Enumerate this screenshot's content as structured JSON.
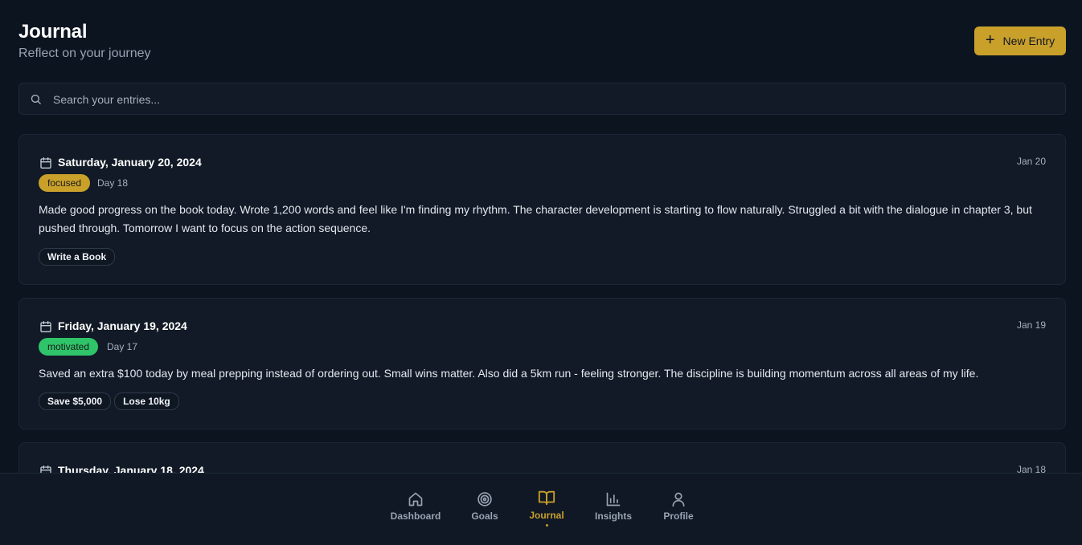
{
  "header": {
    "title": "Journal",
    "subtitle": "Reflect on your journey",
    "new_entry_label": "New Entry"
  },
  "search": {
    "placeholder": "Search your entries..."
  },
  "entries": [
    {
      "date": "Saturday, January 20, 2024",
      "short_date": "Jan 20",
      "mood": "focused",
      "mood_color": "#c9a02a",
      "day": "Day 18",
      "text": "Made good progress on the book today. Wrote 1,200 words and feel like I'm finding my rhythm. The character development is starting to flow naturally. Struggled a bit with the dialogue in chapter 3, but pushed through. Tomorrow I want to focus on the action sequence.",
      "tags": [
        "Write a Book"
      ]
    },
    {
      "date": "Friday, January 19, 2024",
      "short_date": "Jan 19",
      "mood": "motivated",
      "mood_color": "#2fc46a",
      "day": "Day 17",
      "text": "Saved an extra $100 today by meal prepping instead of ordering out. Small wins matter. Also did a 5km run - feeling stronger. The discipline is building momentum across all areas of my life.",
      "tags": [
        "Save $5,000",
        "Lose 10kg"
      ]
    },
    {
      "date": "Thursday, January 18, 2024",
      "short_date": "Jan 18"
    }
  ],
  "nav": {
    "items": [
      {
        "label": "Dashboard",
        "icon": "home-icon"
      },
      {
        "label": "Goals",
        "icon": "target-icon"
      },
      {
        "label": "Journal",
        "icon": "book-open-icon",
        "active": true
      },
      {
        "label": "Insights",
        "icon": "bar-chart-icon"
      },
      {
        "label": "Profile",
        "icon": "user-icon"
      }
    ]
  },
  "colors": {
    "background": "#0c1420",
    "card": "#111a26",
    "accent": "#c9a02a",
    "motivated": "#2fc46a"
  }
}
